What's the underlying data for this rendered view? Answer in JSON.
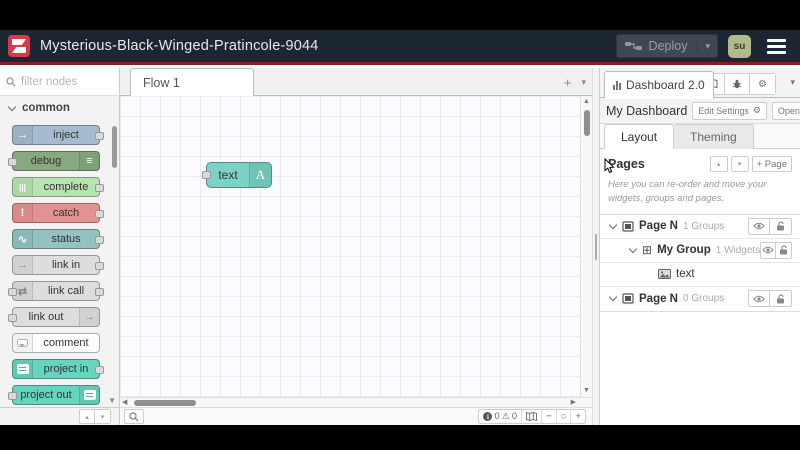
{
  "header": {
    "title": "Mysterious-Black-Winged-Pratincole-9044",
    "deploy_label": "Deploy",
    "avatar_initials": "su"
  },
  "palette": {
    "search_placeholder": "filter nodes",
    "category": "common",
    "nodes": [
      {
        "label": "inject",
        "color": "#a6bbcf",
        "glyph": "→"
      },
      {
        "label": "debug",
        "color": "#87a980",
        "glyph": "≡"
      },
      {
        "label": "complete",
        "color": "#b8e3b2",
        "glyph": "|||"
      },
      {
        "label": "catch",
        "color": "#e49191",
        "glyph": "!"
      },
      {
        "label": "status",
        "color": "#94c1c1",
        "glyph": "∿"
      },
      {
        "label": "link in",
        "color": "#dddddd",
        "glyph": "→"
      },
      {
        "label": "link call",
        "color": "#dddddd",
        "glyph": "⇄"
      },
      {
        "label": "link out",
        "color": "#dddddd",
        "glyph": "→"
      },
      {
        "label": "comment",
        "color": "#ffffff",
        "glyph": ""
      },
      {
        "label": "project in",
        "color": "#65d4c0",
        "glyph": ""
      },
      {
        "label": "project out",
        "color": "#65d4c0",
        "glyph": ""
      }
    ]
  },
  "canvas": {
    "tab_label": "Flow 1",
    "node": {
      "label": "text",
      "icon_glyph": "A",
      "color": "#7bd2c5"
    },
    "status": {
      "info_count": "0",
      "warn_count": "0"
    }
  },
  "sidebar": {
    "tab_title": "Dashboard 2.0",
    "dashboard_name": "My Dashboard",
    "edit_settings_label": "Edit Settings",
    "open_dashboard_label": "Open Dashboard",
    "layout_tab": "Layout",
    "theming_tab": "Theming",
    "pages_heading": "Pages",
    "add_page_label": "+ Page",
    "help_text": "Here you can re-order and move your widgets, groups and pages.",
    "tree": [
      {
        "label": "Page N",
        "meta": "1 Groups"
      },
      {
        "label": "My Group",
        "meta": "1 Widgets"
      },
      {
        "label": "text",
        "meta": ""
      },
      {
        "label": "Page N",
        "meta": "0 Groups"
      }
    ]
  },
  "icons": {
    "plus": "+",
    "minus": "−",
    "zoom_reset": "○",
    "warning": "⚠",
    "gear": "⚙",
    "caret_down": "▾",
    "caret_up": "▴",
    "tri_left": "◀",
    "tri_right": "▶",
    "tri_up": "▲",
    "tri_down": "▼",
    "info_i": "i",
    "group_table": "⊞"
  }
}
